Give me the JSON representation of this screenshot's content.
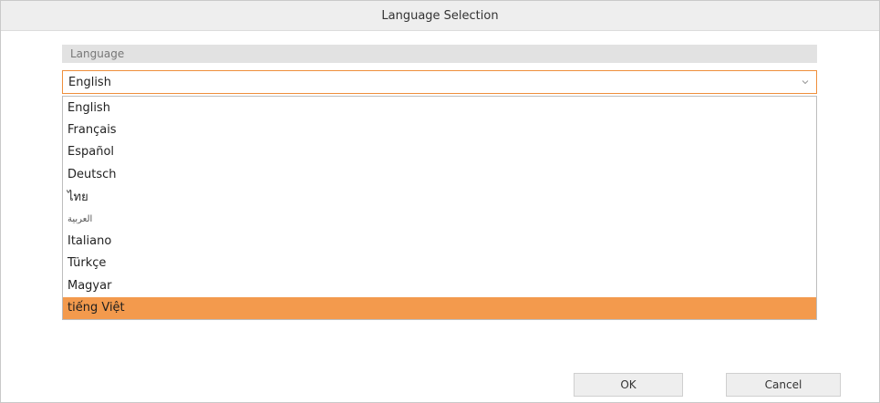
{
  "dialog": {
    "title": "Language Selection"
  },
  "section": {
    "header": "Language"
  },
  "select": {
    "value": "English",
    "chevron_icon": "chevron-down-icon"
  },
  "dropdown": {
    "options": [
      {
        "label": "English",
        "selected": false
      },
      {
        "label": "Français",
        "selected": false
      },
      {
        "label": "Español",
        "selected": false
      },
      {
        "label": "Deutsch",
        "selected": false
      },
      {
        "label": "ไทย",
        "selected": false
      },
      {
        "label": "العربية",
        "selected": false
      },
      {
        "label": "Italiano",
        "selected": false
      },
      {
        "label": "Türkçe",
        "selected": false
      },
      {
        "label": "Magyar",
        "selected": false
      },
      {
        "label": "tiếng Việt",
        "selected": true
      }
    ]
  },
  "buttons": {
    "ok": "OK",
    "cancel": "Cancel"
  },
  "colors": {
    "accent": "#ef8f3c",
    "selected_bg": "#f39a4d"
  }
}
